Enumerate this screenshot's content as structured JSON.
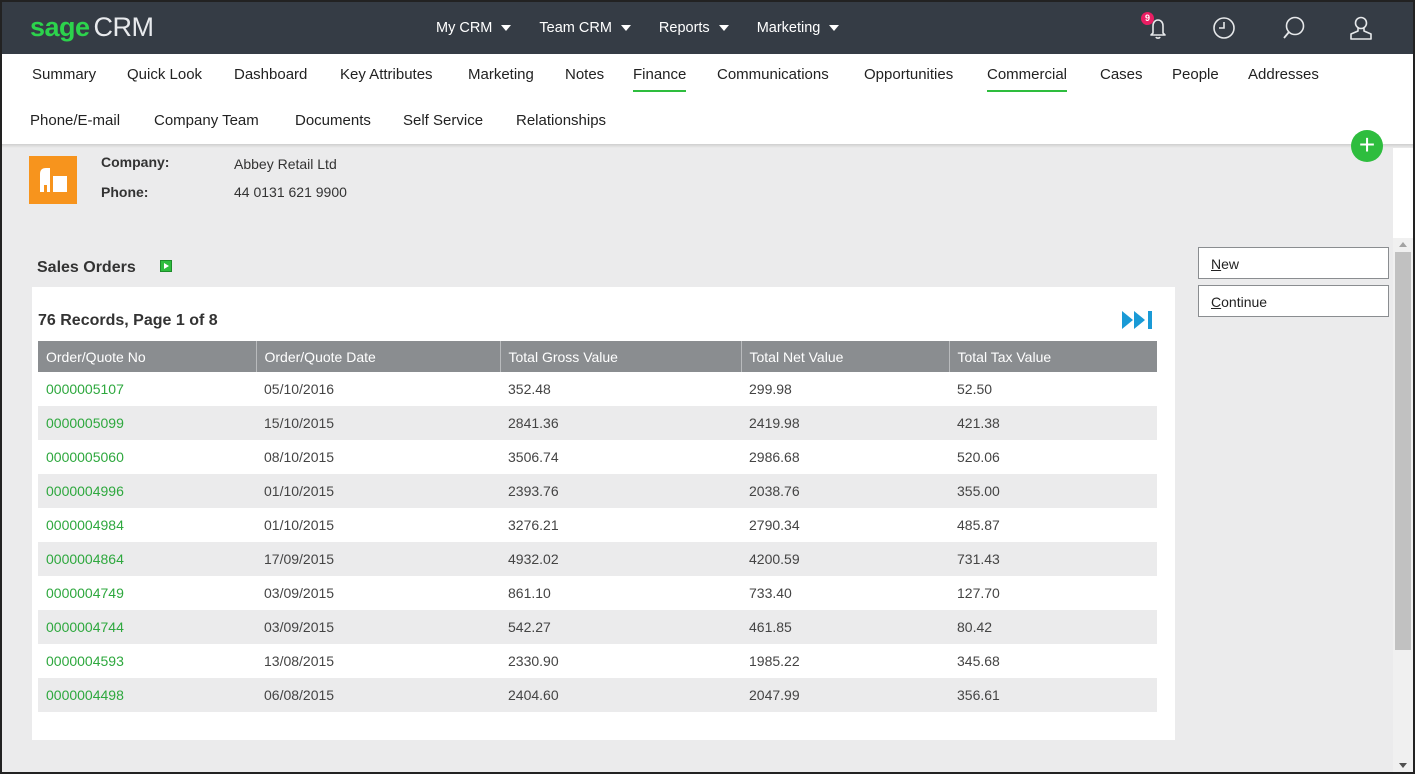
{
  "brand": {
    "sage": "sage",
    "crm": "CRM"
  },
  "top_menu": [
    "My CRM",
    "Team CRM",
    "Reports",
    "Marketing"
  ],
  "notifications": {
    "count": "9"
  },
  "icons": [
    "bell-icon",
    "clock-icon",
    "search-icon",
    "user-icon"
  ],
  "tabs_row1": [
    "Summary",
    "Quick Look",
    "Dashboard",
    "Key Attributes",
    "Marketing",
    "Notes",
    "Finance",
    "Communications",
    "Opportunities",
    "Commercial",
    "Cases",
    "People",
    "Addresses"
  ],
  "tabs_row2": [
    "Phone/E-mail",
    "Company Team",
    "Documents",
    "Self Service",
    "Relationships"
  ],
  "active_tabs": [
    "Finance",
    "Commercial"
  ],
  "add_button": "+",
  "company": {
    "company_label": "Company:",
    "company_value": "Abbey Retail Ltd",
    "phone_label": "Phone:",
    "phone_value": "44 0131 621 9900"
  },
  "panel": {
    "title": "Sales Orders",
    "records": "76 Records, Page 1 of 8"
  },
  "table": {
    "headers": [
      "Order/Quote No",
      "Order/Quote Date",
      "Total Gross Value",
      "Total Net Value",
      "Total Tax Value"
    ],
    "rows": [
      [
        "0000005107",
        "05/10/2016",
        "352.48",
        "299.98",
        "52.50"
      ],
      [
        "0000005099",
        "15/10/2015",
        "2841.36",
        "2419.98",
        "421.38"
      ],
      [
        "0000005060",
        "08/10/2015",
        "3506.74",
        "2986.68",
        "520.06"
      ],
      [
        "0000004996",
        "01/10/2015",
        "2393.76",
        "2038.76",
        "355.00"
      ],
      [
        "0000004984",
        "01/10/2015",
        "3276.21",
        "2790.34",
        "485.87"
      ],
      [
        "0000004864",
        "17/09/2015",
        "4932.02",
        "4200.59",
        "731.43"
      ],
      [
        "0000004749",
        "03/09/2015",
        "861.10",
        "733.40",
        "127.70"
      ],
      [
        "0000004744",
        "03/09/2015",
        "542.27",
        "461.85",
        "80.42"
      ],
      [
        "0000004593",
        "13/08/2015",
        "2330.90",
        "1985.22",
        "345.68"
      ],
      [
        "0000004498",
        "06/08/2015",
        "2404.60",
        "2047.99",
        "356.61"
      ]
    ]
  },
  "side_buttons": {
    "new_first": "N",
    "new_rest": "ew",
    "continue_first": "C",
    "continue_rest": "ontinue"
  },
  "colors": {
    "accent": "#2ebd3e",
    "topbar": "#353c45",
    "company_icon": "#f7941d",
    "link": "#2ea83e",
    "pager": "#1a9ad6"
  }
}
